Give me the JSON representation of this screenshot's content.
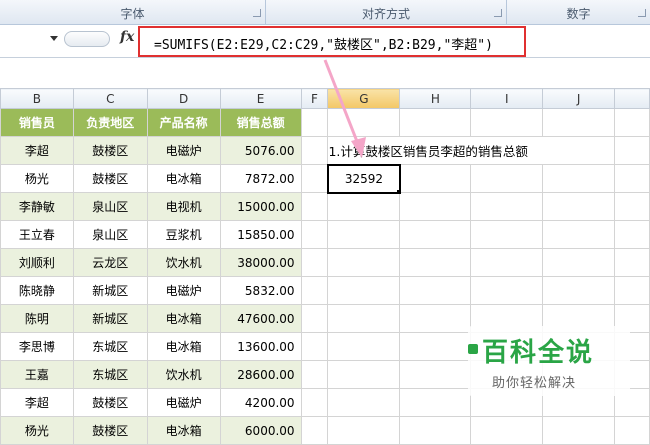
{
  "ribbon": {
    "groups": [
      {
        "label": "字体"
      },
      {
        "label": "对齐方式"
      },
      {
        "label": "数字"
      }
    ]
  },
  "formula_bar": {
    "name_box": "",
    "fx_label": "fx",
    "formula": "=SUMIFS(E2:E29,C2:C29,\"鼓楼区\",B2:B29,\"李超\")"
  },
  "columns": [
    "B",
    "C",
    "D",
    "E",
    "F",
    "G",
    "H",
    "I",
    "J",
    ""
  ],
  "selected_column": "G",
  "table": {
    "headers": [
      "销售员",
      "负责地区",
      "产品名称",
      "销售总额"
    ],
    "rows": [
      [
        "李超",
        "鼓楼区",
        "电磁炉",
        "5076.00"
      ],
      [
        "杨光",
        "鼓楼区",
        "电冰箱",
        "7872.00"
      ],
      [
        "李静敏",
        "泉山区",
        "电视机",
        "15000.00"
      ],
      [
        "王立春",
        "泉山区",
        "豆浆机",
        "15850.00"
      ],
      [
        "刘顺利",
        "云龙区",
        "饮水机",
        "38000.00"
      ],
      [
        "陈晓静",
        "新城区",
        "电磁炉",
        "5832.00"
      ],
      [
        "陈明",
        "新城区",
        "电冰箱",
        "47600.00"
      ],
      [
        "李思博",
        "东城区",
        "电冰箱",
        "13600.00"
      ],
      [
        "王嘉",
        "东城区",
        "饮水机",
        "28600.00"
      ],
      [
        "李超",
        "鼓楼区",
        "电磁炉",
        "4200.00"
      ],
      [
        "杨光",
        "鼓楼区",
        "电冰箱",
        "6000.00"
      ]
    ]
  },
  "note": "1.计算鼓楼区销售员李超的销售总额",
  "result": "32592",
  "watermark": {
    "title": "百科全说",
    "subtitle": "助你轻松解决"
  },
  "colors": {
    "header_green": "#9bbb59",
    "band_green": "#ebf1de",
    "highlight_red": "#e03030",
    "arrow_pink": "#f4a6c8"
  }
}
